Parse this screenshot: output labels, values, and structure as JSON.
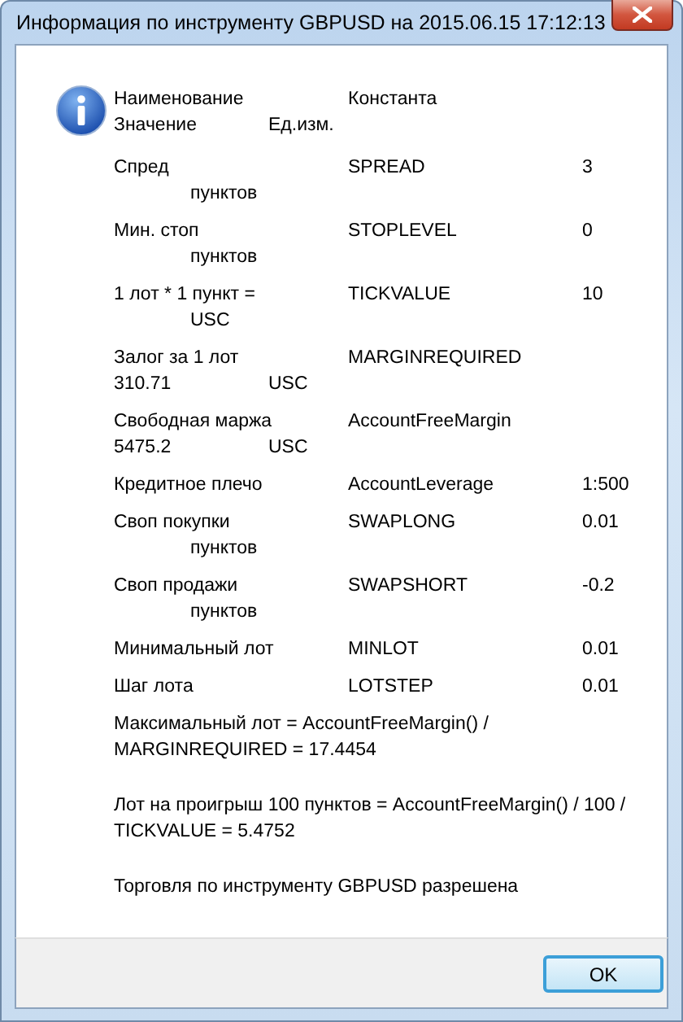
{
  "window": {
    "title": "Информация по инструменту GBPUSD на 2015.06.15 17:12:13"
  },
  "message": {
    "rows": [
      {
        "label": "Наименование",
        "constant": "Константа",
        "line2_value": "Значение",
        "line2_unit": "Ед.изм."
      },
      {
        "label": "Спред",
        "constant": "SPREAD",
        "value": "3",
        "line2_unit": "пунктов"
      },
      {
        "label": "Мин. стоп",
        "constant": "STOPLEVEL",
        "value": "0",
        "line2_unit": "пунктов"
      },
      {
        "label": "1 лот * 1 пункт =",
        "constant": "TICKVALUE",
        "value": "10",
        "line2_unit": "USC"
      },
      {
        "label": "Залог за 1 лот",
        "constant": "MARGINREQUIRED",
        "line2_value": "310.71",
        "line2_unit": "USC"
      },
      {
        "label": "Свободная маржа",
        "constant": "AccountFreeMargin",
        "line2_value": "5475.2",
        "line2_unit": "USC"
      },
      {
        "label": "Кредитное плечо",
        "constant": "AccountLeverage",
        "value": "1:500"
      },
      {
        "label": "Своп покупки",
        "constant": "SWAPLONG",
        "value": "0.01",
        "line2_unit": "пунктов"
      },
      {
        "label": "Своп продажи",
        "constant": "SWAPSHORT",
        "value": "-0.2",
        "line2_unit": "пунктов"
      },
      {
        "label": "Минимальный лот",
        "constant": "MINLOT",
        "value": "0.01"
      },
      {
        "label": "Шаг лота",
        "constant": "LOTSTEP",
        "value": "0.01"
      }
    ],
    "paragraphs": [
      "Максимальный лот = AccountFreeMargin() / MARGINREQUIRED = 17.4454",
      "Лот на проигрыш 100 пунктов = AccountFreeMargin() / 100 / TICKVALUE = 5.4752",
      "Торговля по инструменту GBPUSD разрешена"
    ]
  },
  "buttons": [
    "OK"
  ]
}
